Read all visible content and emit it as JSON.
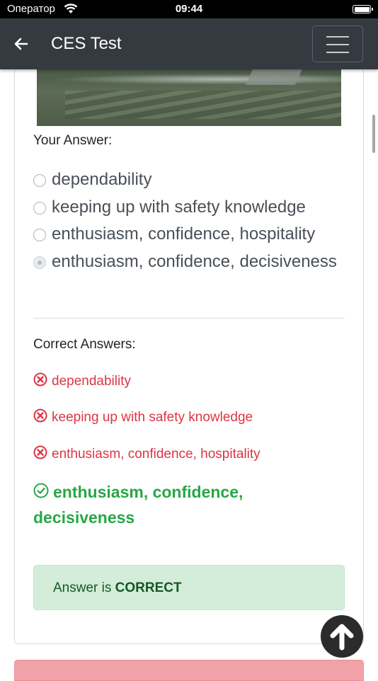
{
  "status_bar": {
    "carrier": "Оператор",
    "time": "09:44"
  },
  "navbar": {
    "title": "CES Test"
  },
  "question": {
    "your_answer_label": "Your Answer:",
    "options": [
      "dependability",
      "keeping up with safety knowledge",
      "enthusiasm, confidence, hospitality",
      "enthusiasm, confidence, decisiveness"
    ],
    "selected_option": 4
  },
  "correct_answers": {
    "label": "Correct Answers:",
    "wrong": [
      "dependability",
      "keeping up with safety knowledge",
      "enthusiasm, confidence, hospitality"
    ],
    "right": "enthusiasm, confidence, decisiveness"
  },
  "result": {
    "prefix": "Answer is",
    "verdict": "CORRECT"
  },
  "colors": {
    "navbar": "#343a40",
    "wrong": "#dc3545",
    "right": "#28a745",
    "alert_bg": "#d4edda",
    "alert_text": "#155724"
  }
}
